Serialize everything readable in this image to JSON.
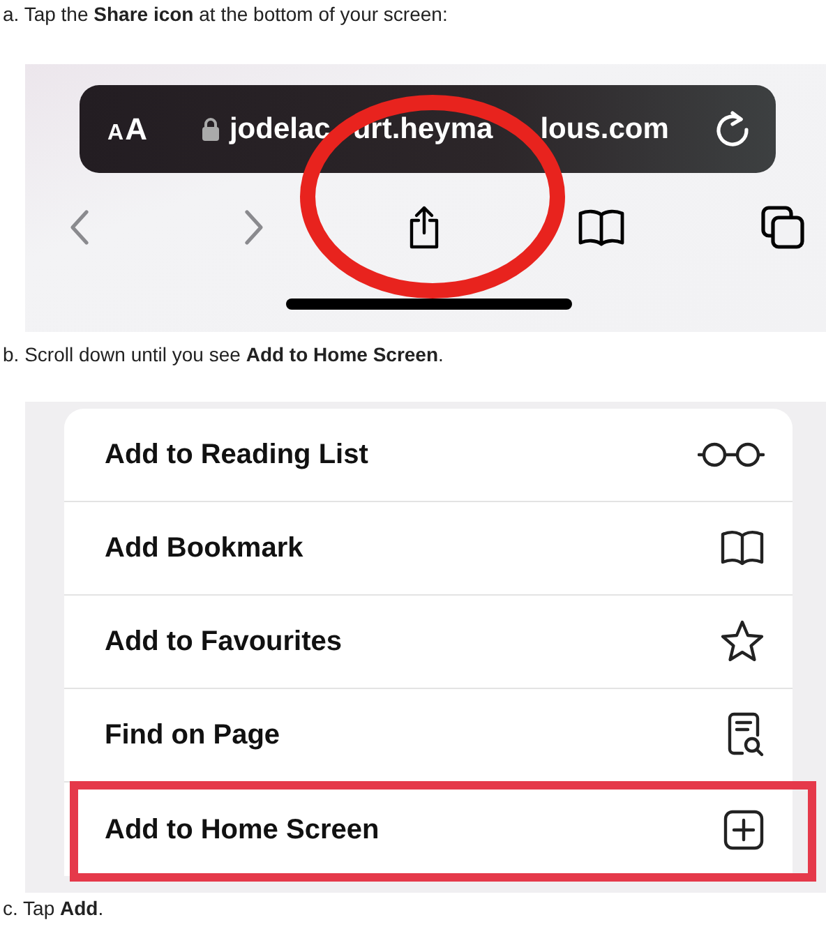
{
  "steps": [
    {
      "text": "a. Tap the **Share icon** at the bottom of your screen:"
    },
    {
      "text": "b. Scroll down until you see **Add to Home Screen**."
    },
    {
      "text": "c. Tap **Add**."
    }
  ],
  "browser_screenshot": {
    "text_size_button": "AA",
    "url_fragments": [
      "jodelac",
      "urt.heyma",
      "lous.com"
    ]
  },
  "share_menu_screenshot": {
    "items": [
      {
        "label": "Add to Reading List",
        "kind": "glasses",
        "highlighted": false
      },
      {
        "label": "Add Bookmark",
        "kind": "book",
        "highlighted": false
      },
      {
        "label": "Add to Favourites",
        "kind": "star",
        "highlighted": false
      },
      {
        "label": "Find on Page",
        "kind": "find",
        "highlighted": false
      },
      {
        "label": "Add to Home Screen",
        "kind": "add",
        "highlighted": true
      }
    ]
  }
}
